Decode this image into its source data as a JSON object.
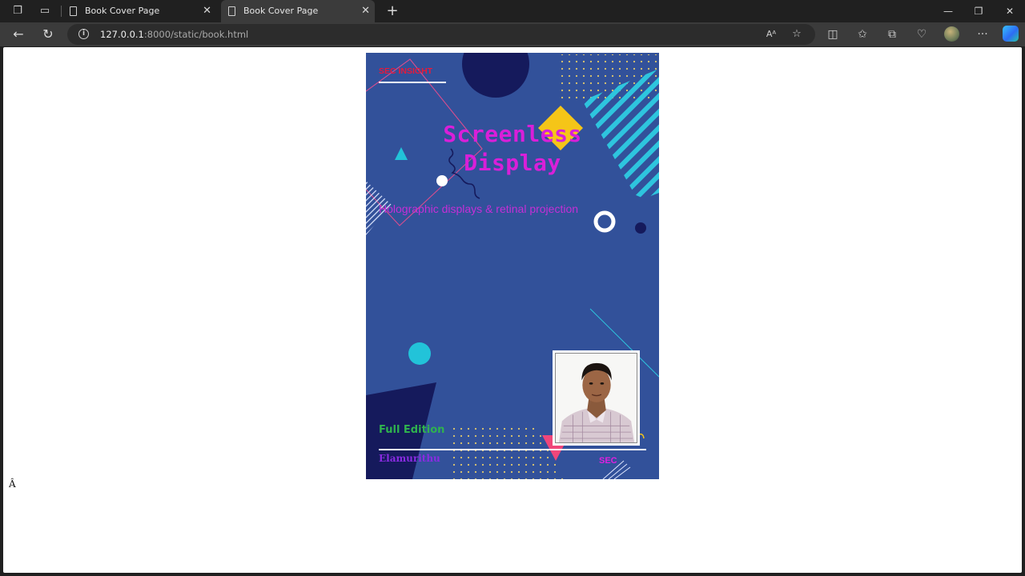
{
  "browser": {
    "tabs": [
      {
        "title": "Book Cover Page",
        "active": false
      },
      {
        "title": "Book Cover Page",
        "active": true
      }
    ],
    "url_host": "127.0.0.1",
    "url_rest": ":8000/static/book.html",
    "icons": {
      "workspaces": "workspaces-icon",
      "tab_actions": "tab-actions-icon",
      "new_tab": "plus-icon",
      "back": "back-arrow-icon",
      "refresh": "refresh-icon",
      "site_info": "info-icon",
      "read_aloud": "read-aloud-icon",
      "favorite": "star-icon",
      "split": "split-screen-icon",
      "favorites": "favorites-icon",
      "collections": "collections-icon",
      "browser_essentials": "heart-pulse-icon",
      "more": "more-dots-icon",
      "copilot": "copilot-icon"
    }
  },
  "page": {
    "stray_char": "Â"
  },
  "cover": {
    "brand": "SEC INSIGHT",
    "title_line1": "Screenless",
    "title_line2": "Display",
    "subtitle": "Holographic displays & retinal projection",
    "edition": "Full Edition",
    "author": "Elamurithu",
    "publisher": "SEC",
    "colors": {
      "background": "#32519a",
      "title": "#d91fd9",
      "subtitle": "#c52fd6",
      "brand": "#e8193b",
      "edition": "#2fb24e",
      "author": "#8a2be2",
      "accent_yellow": "#f5c518",
      "accent_cyan": "#22c3d9",
      "accent_pink": "#f0467a",
      "navy": "#151a5c"
    }
  }
}
